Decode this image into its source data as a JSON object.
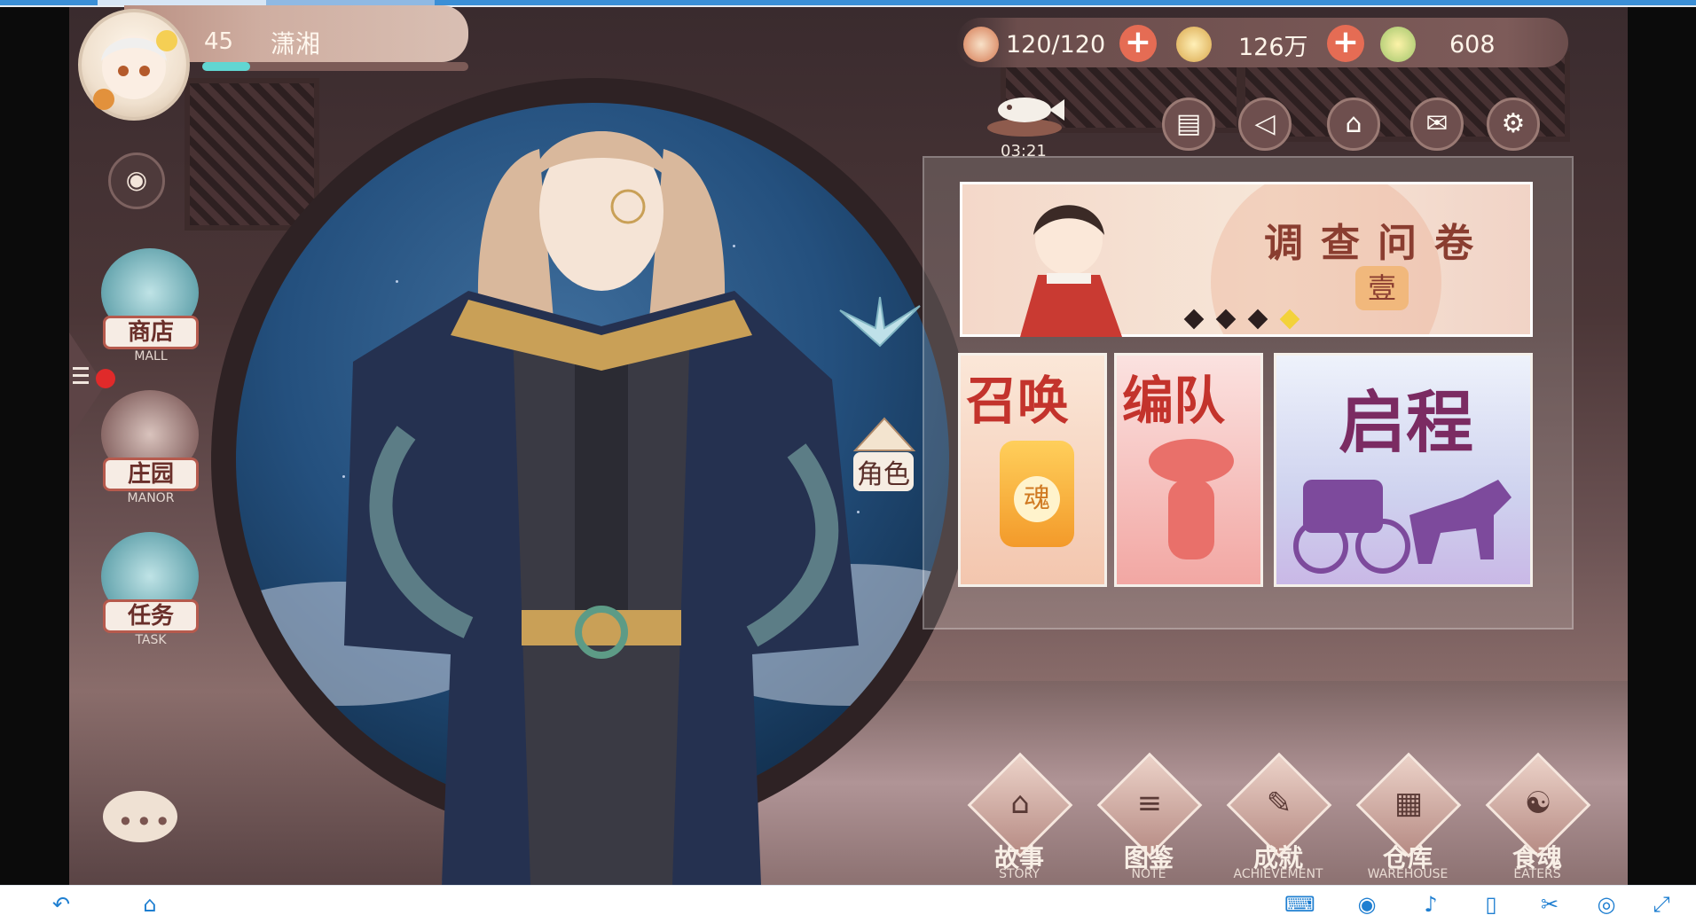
{
  "player": {
    "level": "45",
    "name": "潇湘",
    "xp_fraction": 0.18
  },
  "resources": [
    {
      "icon": "rice-bowl-icon",
      "value": "120/120"
    },
    {
      "icon": "coin-icon",
      "value": "126万"
    },
    {
      "icon": "jade-icon",
      "value": "608"
    }
  ],
  "timer": "03:21",
  "top_icons": [
    "announcement-board-icon",
    "megaphone-icon",
    "house-icon",
    "mail-icon",
    "gear-icon"
  ],
  "left_menu": [
    {
      "cn": "商店",
      "en": "MALL"
    },
    {
      "cn": "庄园",
      "en": "MANOR"
    },
    {
      "cn": "任务",
      "en": "TASK"
    }
  ],
  "role_tag": "角色",
  "banner": {
    "title": "调查问卷",
    "seal": "壹"
  },
  "cards": [
    {
      "title": "召唤",
      "badge": "魂"
    },
    {
      "title": "编队"
    },
    {
      "title": "启程"
    }
  ],
  "bottom_menu": [
    {
      "cn": "故事",
      "en": "STORY"
    },
    {
      "cn": "图鉴",
      "en": "NOTE"
    },
    {
      "cn": "成就",
      "en": "ACHIEVEMENT"
    },
    {
      "cn": "仓库",
      "en": "WAREHOUSE"
    },
    {
      "cn": "食魂",
      "en": "EATERS"
    }
  ],
  "colors": {
    "accent_red": "#e56c54",
    "xp_teal": "#61d6d2",
    "nav_blue": "#1f7fd1"
  }
}
